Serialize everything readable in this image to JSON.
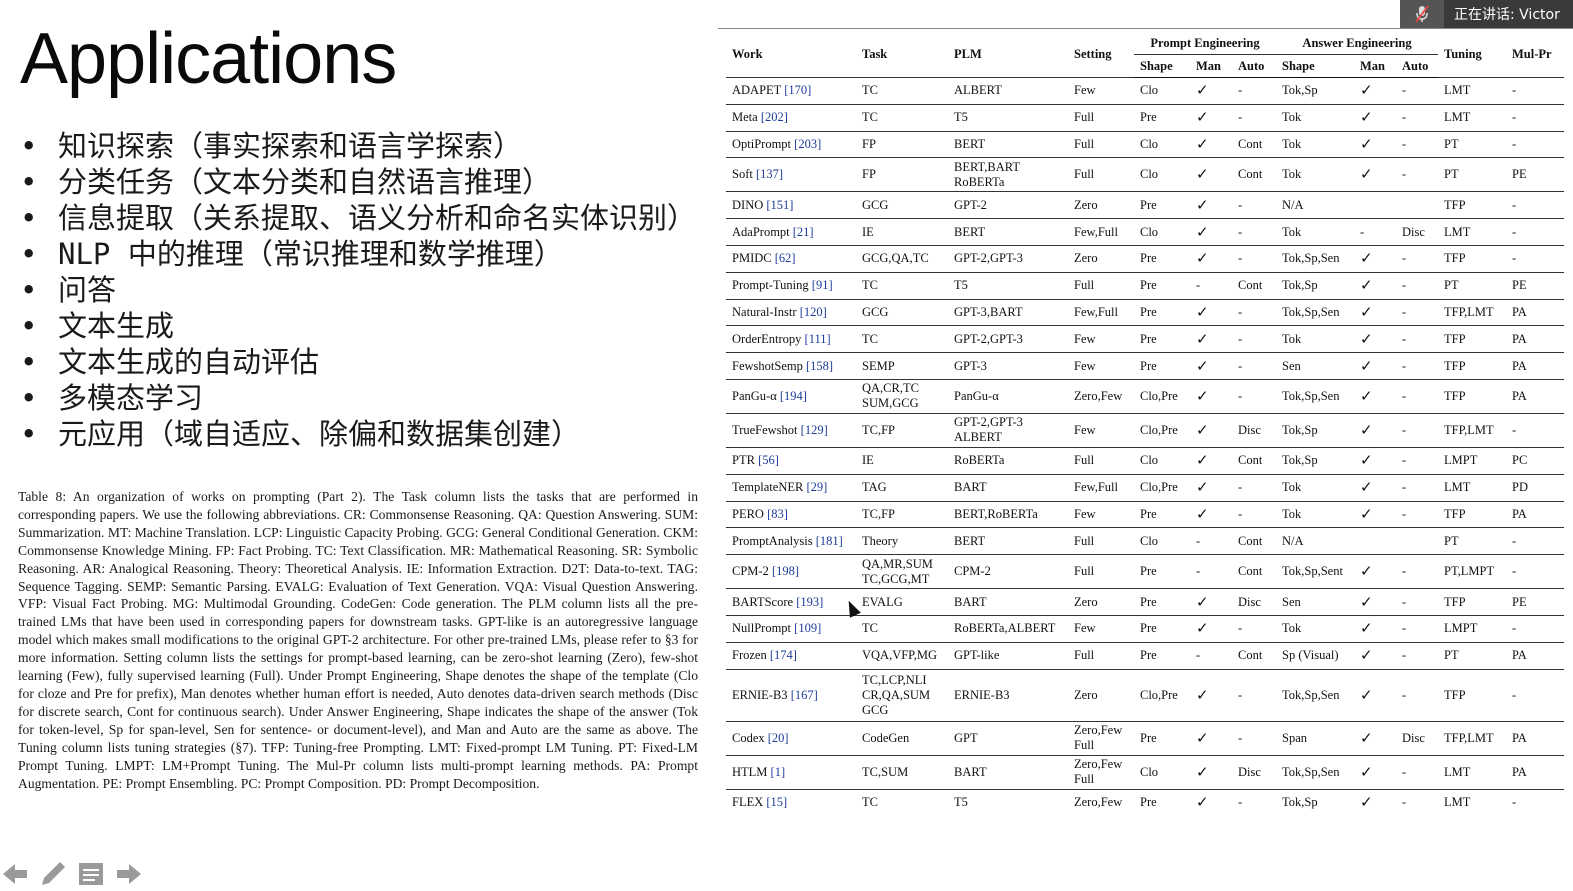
{
  "slide": {
    "title": "Applications",
    "bullets": [
      "知识探索（事实探索和语言学探索）",
      "分类任务（文本分类和自然语言推理）",
      "信息提取（关系提取、语义分析和命名实体识别）",
      "NLP 中的推理（常识推理和数学推理）",
      "问答",
      "文本生成",
      "文本生成的自动评估",
      "多模态学习",
      "元应用（域自适应、除偏和数据集创建）"
    ],
    "bullet_symbol": "•"
  },
  "speaker_indicator": {
    "text": "正在讲话: Victor",
    "icon": "muted-mic-icon"
  },
  "caption": {
    "label": "Table 8:",
    "text": "An organization of works on prompting (Part 2). The Task column lists the tasks that are performed in corresponding papers. We use the following abbreviations. CR: Commonsense Reasoning. QA: Question Answering. SUM: Summarization. MT: Machine Translation. LCP: Linguistic Capacity Probing. GCG: General Conditional Generation. CKM: Commonsense Knowledge Mining. FP: Fact Probing. TC: Text Classification. MR: Mathematical Reasoning. SR: Symbolic Reasoning. AR: Analogical Reasoning. Theory: Theoretical Analysis. IE: Information Extraction. D2T: Data-to-text. TAG: Sequence Tagging. SEMP: Semantic Parsing. EVALG: Evaluation of Text Generation. VQA: Visual Question Answering. VFP: Visual Fact Probing. MG: Multimodal Grounding. CodeGen: Code generation. The PLM column lists all the pre-trained LMs that have been used in corresponding papers for downstream tasks. GPT-like is an autoregressive language model which makes small modifications to the original GPT-2 architecture. For other pre-trained LMs, please refer to §3 for more information. Setting column lists the settings for prompt-based learning, can be zero-shot learning (Zero), few-shot learning (Few), fully supervised learning (Full). Under Prompt Engineering, Shape denotes the shape of the template (Clo for cloze and Pre for prefix), Man denotes whether human effort is needed, Auto denotes data-driven search methods (Disc for discrete search, Cont for continuous search). Under Answer Engineering, Shape indicates the shape of the answer (Tok for token-level, Sp for span-level, Sen for sentence- or document-level), and Man and Auto are the same as above. The Tuning column lists tuning strategies (§7). TFP: Tuning-free Prompting. LMT: Fixed-prompt LM Tuning. PT: Fixed-LM Prompt Tuning. LMPT: LM+Prompt Tuning. The Mul-Pr column lists multi-prompt learning methods. PA: Prompt Augmentation. PE: Prompt Ensembling. PC: Prompt Composition. PD: Prompt Decomposition."
  },
  "table": {
    "group_headers": {
      "prompt_engineering": "Prompt Engineering",
      "answer_engineering": "Answer Engineering"
    },
    "columns": {
      "work": "Work",
      "task": "Task",
      "plm": "PLM",
      "setting": "Setting",
      "p_shape": "Shape",
      "p_man": "Man",
      "p_auto": "Auto",
      "a_shape": "Shape",
      "a_man": "Man",
      "a_auto": "Auto",
      "tuning": "Tuning",
      "mulpr": "Mul-Pr"
    },
    "rows": [
      {
        "work": "ADAPET",
        "cite": "[170]",
        "task": "TC",
        "plm": "ALBERT",
        "setting": "Few",
        "pshape": "Clo",
        "pman": "✓",
        "pauto": "-",
        "ashape": "Tok,Sp",
        "aman": "✓",
        "aauto": "-",
        "tuning": "LMT",
        "mulpr": "-"
      },
      {
        "work": "Meta",
        "cite": "[202]",
        "task": "TC",
        "plm": "T5",
        "setting": "Full",
        "pshape": "Pre",
        "pman": "✓",
        "pauto": "-",
        "ashape": "Tok",
        "aman": "✓",
        "aauto": "-",
        "tuning": "LMT",
        "mulpr": "-"
      },
      {
        "work": "OptiPrompt",
        "cite": "[203]",
        "task": "FP",
        "plm": "BERT",
        "setting": "Full",
        "pshape": "Clo",
        "pman": "✓",
        "pauto": "Cont",
        "ashape": "Tok",
        "aman": "✓",
        "aauto": "-",
        "tuning": "PT",
        "mulpr": "-"
      },
      {
        "work": "Soft",
        "cite": "[137]",
        "task": "FP",
        "plm": "BERT,BART RoBERTa",
        "setting": "Full",
        "pshape": "Clo",
        "pman": "✓",
        "pauto": "Cont",
        "ashape": "Tok",
        "aman": "✓",
        "aauto": "-",
        "tuning": "PT",
        "mulpr": "PE"
      },
      {
        "work": "DINO",
        "cite": "[151]",
        "task": "GCG",
        "plm": "GPT-2",
        "setting": "Zero",
        "pshape": "Pre",
        "pman": "✓",
        "pauto": "-",
        "ashape": "N/A",
        "aman": "",
        "aauto": "",
        "tuning": "TFP",
        "mulpr": "-"
      },
      {
        "work": "AdaPrompt",
        "cite": "[21]",
        "task": "IE",
        "plm": "BERT",
        "setting": "Few,Full",
        "pshape": "Clo",
        "pman": "✓",
        "pauto": "-",
        "ashape": "Tok",
        "aman": "-",
        "aauto": "Disc",
        "tuning": "LMT",
        "mulpr": "-"
      },
      {
        "work": "PMIDC",
        "cite": "[62]",
        "task": "GCG,QA,TC",
        "plm": "GPT-2,GPT-3",
        "setting": "Zero",
        "pshape": "Pre",
        "pman": "✓",
        "pauto": "-",
        "ashape": "Tok,Sp,Sen",
        "aman": "✓",
        "aauto": "-",
        "tuning": "TFP",
        "mulpr": "-"
      },
      {
        "work": "Prompt-Tuning",
        "cite": "[91]",
        "task": "TC",
        "plm": "T5",
        "setting": "Full",
        "pshape": "Pre",
        "pman": "-",
        "pauto": "Cont",
        "ashape": "Tok,Sp",
        "aman": "✓",
        "aauto": "-",
        "tuning": "PT",
        "mulpr": "PE"
      },
      {
        "work": "Natural-Instr",
        "cite": "[120]",
        "task": "GCG",
        "plm": "GPT-3,BART",
        "setting": "Few,Full",
        "pshape": "Pre",
        "pman": "✓",
        "pauto": "-",
        "ashape": "Tok,Sp,Sen",
        "aman": "✓",
        "aauto": "-",
        "tuning": "TFP,LMT",
        "mulpr": "PA"
      },
      {
        "work": "OrderEntropy",
        "cite": "[111]",
        "task": "TC",
        "plm": "GPT-2,GPT-3",
        "setting": "Few",
        "pshape": "Pre",
        "pman": "✓",
        "pauto": "-",
        "ashape": "Tok",
        "aman": "✓",
        "aauto": "-",
        "tuning": "TFP",
        "mulpr": "PA"
      },
      {
        "work": "FewshotSemp",
        "cite": "[158]",
        "task": "SEMP",
        "plm": "GPT-3",
        "setting": "Few",
        "pshape": "Pre",
        "pman": "✓",
        "pauto": "-",
        "ashape": "Sen",
        "aman": "✓",
        "aauto": "-",
        "tuning": "TFP",
        "mulpr": "PA"
      },
      {
        "work": "PanGu-α",
        "cite": "[194]",
        "task": "QA,CR,TC SUM,GCG",
        "plm": "PanGu-α",
        "setting": "Zero,Few",
        "pshape": "Clo,Pre",
        "pman": "✓",
        "pauto": "-",
        "ashape": "Tok,Sp,Sen",
        "aman": "✓",
        "aauto": "-",
        "tuning": "TFP",
        "mulpr": "PA"
      },
      {
        "work": "TrueFewshot",
        "cite": "[129]",
        "task": "TC,FP",
        "plm": "GPT-2,GPT-3 ALBERT",
        "setting": "Few",
        "pshape": "Clo,Pre",
        "pman": "✓",
        "pauto": "Disc",
        "ashape": "Tok,Sp",
        "aman": "✓",
        "aauto": "-",
        "tuning": "TFP,LMT",
        "mulpr": "-"
      },
      {
        "work": "PTR",
        "cite": "[56]",
        "task": "IE",
        "plm": "RoBERTa",
        "setting": "Full",
        "pshape": "Clo",
        "pman": "✓",
        "pauto": "Cont",
        "ashape": "Tok,Sp",
        "aman": "✓",
        "aauto": "-",
        "tuning": "LMPT",
        "mulpr": "PC"
      },
      {
        "work": "TemplateNER",
        "cite": "[29]",
        "task": "TAG",
        "plm": "BART",
        "setting": "Few,Full",
        "pshape": "Clo,Pre",
        "pman": "✓",
        "pauto": "-",
        "ashape": "Tok",
        "aman": "✓",
        "aauto": "-",
        "tuning": "LMT",
        "mulpr": "PD"
      },
      {
        "work": "PERO",
        "cite": "[83]",
        "task": "TC,FP",
        "plm": "BERT,RoBERTa",
        "setting": "Few",
        "pshape": "Pre",
        "pman": "✓",
        "pauto": "-",
        "ashape": "Tok",
        "aman": "✓",
        "aauto": "-",
        "tuning": "TFP",
        "mulpr": "PA"
      },
      {
        "work": "PromptAnalysis",
        "cite": "[181]",
        "task": "Theory",
        "plm": "BERT",
        "setting": "Full",
        "pshape": "Clo",
        "pman": "-",
        "pauto": "Cont",
        "ashape": "N/A",
        "aman": "",
        "aauto": "",
        "tuning": "PT",
        "mulpr": "-"
      },
      {
        "work": "CPM-2",
        "cite": "[198]",
        "task": "QA,MR,SUM TC,GCG,MT",
        "plm": "CPM-2",
        "setting": "Full",
        "pshape": "Pre",
        "pman": "-",
        "pauto": "Cont",
        "ashape": "Tok,Sp,Sent",
        "aman": "✓",
        "aauto": "-",
        "tuning": "PT,LMPT",
        "mulpr": "-"
      },
      {
        "work": "BARTScore",
        "cite": "[193]",
        "task": "EVALG",
        "plm": "BART",
        "setting": "Zero",
        "pshape": "Pre",
        "pman": "✓",
        "pauto": "Disc",
        "ashape": "Sen",
        "aman": "✓",
        "aauto": "-",
        "tuning": "TFP",
        "mulpr": "PE"
      },
      {
        "work": "NullPrompt",
        "cite": "[109]",
        "task": "TC",
        "plm": "RoBERTa,ALBERT",
        "setting": "Few",
        "pshape": "Pre",
        "pman": "✓",
        "pauto": "-",
        "ashape": "Tok",
        "aman": "✓",
        "aauto": "-",
        "tuning": "LMPT",
        "mulpr": "-"
      },
      {
        "work": "Frozen",
        "cite": "[174]",
        "task": "VQA,VFP,MG",
        "plm": "GPT-like",
        "setting": "Full",
        "pshape": "Pre",
        "pman": "-",
        "pauto": "Cont",
        "ashape": "Sp (Visual)",
        "aman": "✓",
        "aauto": "-",
        "tuning": "PT",
        "mulpr": "PA"
      },
      {
        "work": "ERNIE-B3",
        "cite": "[167]",
        "task": "TC,LCP,NLI CR,QA,SUM GCG",
        "plm": "ERNIE-B3",
        "setting": "Zero",
        "pshape": "Clo,Pre",
        "pman": "✓",
        "pauto": "-",
        "ashape": "Tok,Sp,Sen",
        "aman": "✓",
        "aauto": "-",
        "tuning": "TFP",
        "mulpr": "-"
      },
      {
        "work": "Codex",
        "cite": "[20]",
        "task": "CodeGen",
        "plm": "GPT",
        "setting": "Zero,Few Full",
        "pshape": "Pre",
        "pman": "✓",
        "pauto": "-",
        "ashape": "Span",
        "aman": "✓",
        "aauto": "Disc",
        "tuning": "TFP,LMT",
        "mulpr": "PA"
      },
      {
        "work": "HTLM",
        "cite": "[1]",
        "task": "TC,SUM",
        "plm": "BART",
        "setting": "Zero,Few Full",
        "pshape": "Clo",
        "pman": "✓",
        "pauto": "Disc",
        "ashape": "Tok,Sp,Sen",
        "aman": "✓",
        "aauto": "-",
        "tuning": "LMT",
        "mulpr": "PA"
      },
      {
        "work": "FLEX",
        "cite": "[15]",
        "task": "TC",
        "plm": "T5",
        "setting": "Zero,Few",
        "pshape": "Pre",
        "pman": "✓",
        "pauto": "-",
        "ashape": "Tok,Sp",
        "aman": "✓",
        "aauto": "-",
        "tuning": "LMT",
        "mulpr": "-"
      }
    ]
  },
  "nav": {
    "icons": [
      "prev-arrow-icon",
      "pen-icon",
      "notes-icon",
      "next-arrow-icon"
    ]
  }
}
